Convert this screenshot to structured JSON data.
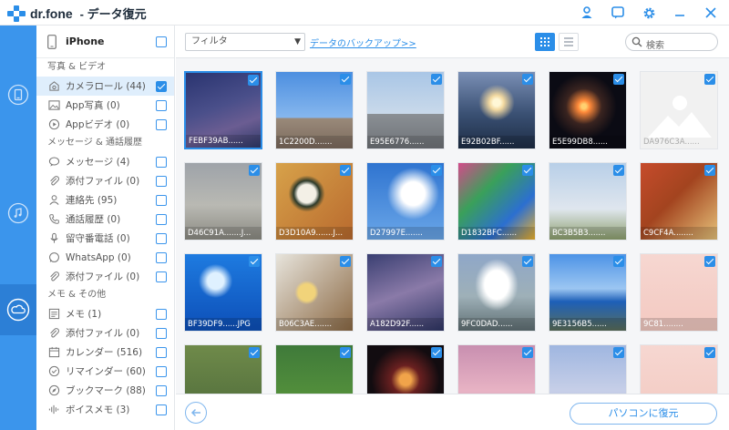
{
  "window": {
    "app_name": "dr.fone",
    "title": "- データ復元"
  },
  "toolbar": {
    "filter_value": "フィルタ",
    "backup_link": "データのバックアップ>>",
    "search_placeholder": "検索"
  },
  "device": {
    "name": "iPhone",
    "checked": false
  },
  "sections": [
    {
      "title": "写真 & ビデオ",
      "items": [
        {
          "label": "カメラロール (44)",
          "icon": "camera-icon",
          "checked": true,
          "active": true
        },
        {
          "label": "App写真 (0)",
          "icon": "image-icon",
          "checked": false
        },
        {
          "label": "Appビデオ (0)",
          "icon": "play-icon",
          "checked": false
        }
      ]
    },
    {
      "title": "メッセージ & 通話履歴",
      "items": [
        {
          "label": "メッセージ (4)",
          "icon": "message-icon",
          "checked": false
        },
        {
          "label": "添付ファイル (0)",
          "icon": "paperclip-icon",
          "checked": false
        },
        {
          "label": "連絡先 (95)",
          "icon": "contact-icon",
          "checked": false
        },
        {
          "label": "通話履歴 (0)",
          "icon": "phone-icon",
          "checked": false
        },
        {
          "label": "留守番電話 (0)",
          "icon": "voicemail-icon",
          "checked": false
        },
        {
          "label": "WhatsApp (0)",
          "icon": "whatsapp-icon",
          "checked": false
        },
        {
          "label": "添付ファイル (0)",
          "icon": "paperclip-icon",
          "checked": false
        }
      ]
    },
    {
      "title": "メモ & その他",
      "items": [
        {
          "label": "メモ (1)",
          "icon": "note-icon",
          "checked": false
        },
        {
          "label": "添付ファイル (0)",
          "icon": "paperclip-icon",
          "checked": false
        },
        {
          "label": "カレンダー (516)",
          "icon": "calendar-icon",
          "checked": false
        },
        {
          "label": "リマインダー (60)",
          "icon": "reminder-icon",
          "checked": false
        },
        {
          "label": "ブックマーク (88)",
          "icon": "compass-icon",
          "checked": false
        },
        {
          "label": "ボイスメモ (3)",
          "icon": "waveform-icon",
          "checked": false
        }
      ]
    }
  ],
  "photos": [
    {
      "caption": "FEBF39AB......",
      "scene": "starry-sky",
      "selected": true
    },
    {
      "caption": "1C2200D.......",
      "scene": "torii-gate"
    },
    {
      "caption": "E95E6776......",
      "scene": "city-statue"
    },
    {
      "caption": "E92B02BF......",
      "scene": "sunset-sea"
    },
    {
      "caption": "E5E99DB8......",
      "scene": "fireworks"
    },
    {
      "caption": "DA976C3A......",
      "scene": "placeholder"
    },
    {
      "caption": "D46C91A.......J...",
      "scene": "rainbow"
    },
    {
      "caption": "D3D10A9.......J...",
      "scene": "sushi"
    },
    {
      "caption": "D27997E.......",
      "scene": "blue-sky"
    },
    {
      "caption": "D1832BFC......",
      "scene": "phone-homescreen"
    },
    {
      "caption": "BC3B5B3.......",
      "scene": "carp-streamers"
    },
    {
      "caption": "C9CF4A........",
      "scene": "japanese-meal"
    },
    {
      "caption": "BF39DF9......JPG",
      "scene": "jellyfish"
    },
    {
      "caption": "B06C3AE.......",
      "scene": "dishes"
    },
    {
      "caption": "A182D92F......",
      "scene": "starry-sky-2"
    },
    {
      "caption": "9FC0DAD......",
      "scene": "swan-boat"
    },
    {
      "caption": "9E3156B5......",
      "scene": "blue-building"
    },
    {
      "caption": "9C81........",
      "scene": "cat-drawing"
    },
    {
      "caption": "",
      "scene": "green-path"
    },
    {
      "caption": "",
      "scene": "green-leaves"
    },
    {
      "caption": "",
      "scene": "lantern-night"
    },
    {
      "caption": "",
      "scene": "pink-sky"
    },
    {
      "caption": "",
      "scene": "blue-dusk"
    },
    {
      "caption": "",
      "scene": "cat-drawing-2"
    }
  ],
  "footer": {
    "recover_button": "パソコンに復元"
  },
  "colors": {
    "accent": "#2b8ee8",
    "rail": "#3b95ec",
    "active_row": "#dfeefc"
  }
}
